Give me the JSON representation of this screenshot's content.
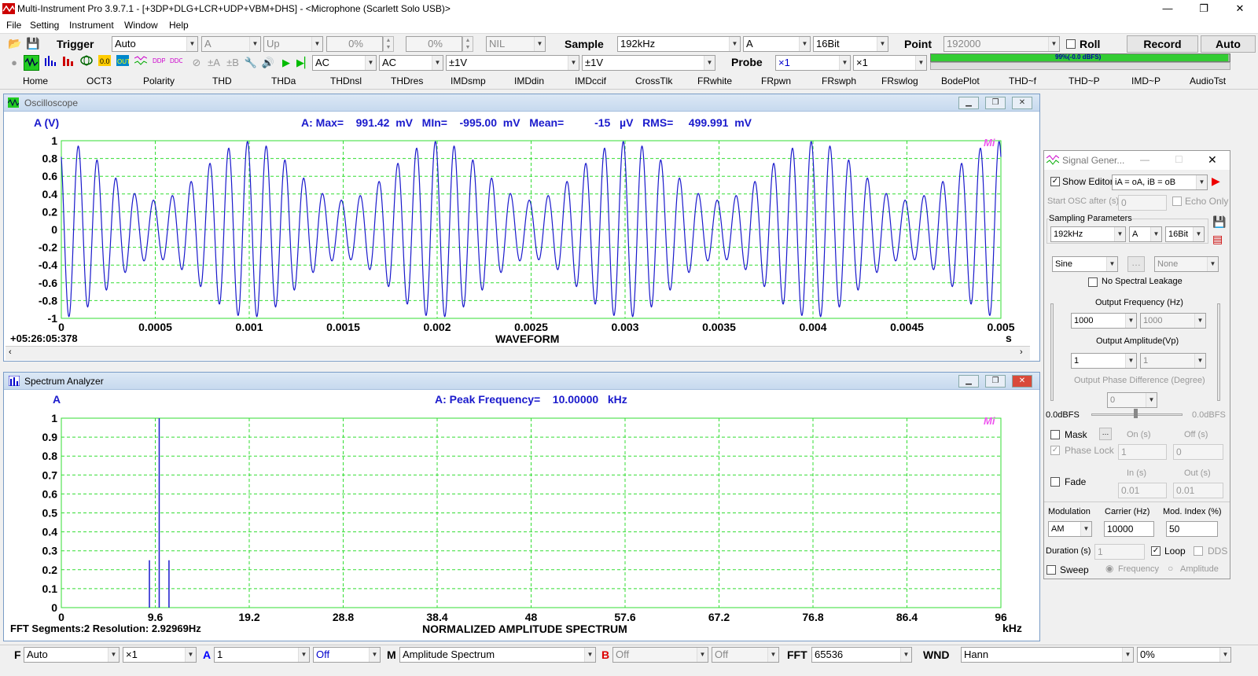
{
  "app": {
    "title": "Multi-Instrument Pro 3.9.7.1  -  [+3DP+DLG+LCR+UDP+VBM+DHS]  -  <Microphone (Scarlett Solo USB)>",
    "win_min": "—",
    "win_max": "❐",
    "win_close": "✕"
  },
  "menu": [
    "File",
    "Setting",
    "Instrument",
    "Window",
    "Help"
  ],
  "toolbar1": {
    "trigger_label": "Trigger",
    "trigger_mode": "Auto",
    "trigger_channel": "A",
    "trigger_edge": "Up",
    "trigger_pct1": "0%",
    "trigger_pct2": "0%",
    "trigger_nil": "NIL",
    "sample_label": "Sample",
    "sample_rate": "192kHz",
    "sample_channel": "A",
    "bit_depth": "16Bit",
    "point_label": "Point",
    "point_value": "192000",
    "roll_label": "Roll",
    "record_label": "Record",
    "auto_label": "Auto"
  },
  "toolbar2": {
    "coupling_a": "AC",
    "coupling_b": "AC",
    "range_a": "±1V",
    "range_b": "±1V",
    "probe_label": "Probe",
    "probe_a": "×1",
    "probe_b": "×1",
    "level_meter": "99%(-0.0 dBFS)",
    "level_fraction": 0.995,
    "icons": [
      "record-dot-icon",
      "oscilloscope-icon",
      "spectrum-icon",
      "bar-meter-icon",
      "phase-icon",
      "generator-icon",
      "multimeter-icon",
      "ddp-icon",
      "ddc-icon",
      "text-a-icon",
      "text-b-icon",
      "probe-icon",
      "speaker-icon",
      "play-icon",
      "play-step-icon"
    ]
  },
  "nav_tabs": [
    "Home",
    "OCT3",
    "Polarity",
    "THD",
    "THDa",
    "THDnsl",
    "THDres",
    "IMDsmp",
    "IMDdin",
    "IMDccif",
    "CrossTlk",
    "FRwhite",
    "FRpwn",
    "FRswph",
    "FRswlog",
    "BodePlot",
    "THD~f",
    "THD~P",
    "IMD~P",
    "AudioTst"
  ],
  "oscilloscope": {
    "window_title": "Oscilloscope",
    "channel_label": "A (V)",
    "stats": "A: Max=    991.42  mV   MIn=    -995.00  mV   Mean=          -15   µV   RMS=     499.991  mV",
    "mi_logo": "Mi",
    "timestamp": "+05:26:05:378",
    "xlabel": "WAVEFORM",
    "xunit": "s",
    "y_ticks": [
      "1",
      "0.8",
      "0.6",
      "0.4",
      "0.2",
      "0",
      "-0.2",
      "-0.4",
      "-0.6",
      "-0.8",
      "-1"
    ],
    "x_ticks": [
      "0",
      "0.0005",
      "0.001",
      "0.0015",
      "0.002",
      "0.0025",
      "0.003",
      "0.0035",
      "0.004",
      "0.0045",
      "0.005"
    ]
  },
  "spectrum": {
    "window_title": "Spectrum Analyzer",
    "channel_label": "A",
    "peak": "A: Peak Frequency=    10.00000   kHz",
    "mi_logo": "Mi",
    "footer_left": "FFT Segments:2   Resolution: 2.92969Hz",
    "xlabel": "NORMALIZED AMPLITUDE SPECTRUM",
    "xunit": "kHz",
    "y_ticks": [
      "1",
      "0.9",
      "0.8",
      "0.7",
      "0.6",
      "0.5",
      "0.4",
      "0.3",
      "0.2",
      "0.1",
      "0"
    ],
    "x_ticks": [
      "0",
      "9.6",
      "19.2",
      "28.8",
      "38.4",
      "48",
      "57.6",
      "67.2",
      "76.8",
      "86.4",
      "96"
    ]
  },
  "chart_data": [
    {
      "type": "line",
      "title": "WAVEFORM",
      "xlabel": "s",
      "ylabel": "A (V)",
      "xlim": [
        0,
        0.005
      ],
      "ylim": [
        -1,
        1
      ],
      "grid": true,
      "signal": "AM sine",
      "carrier_hz": 10000,
      "modulating_hz": 1000,
      "mod_index": 0.5,
      "peak_v": 0.99142,
      "min_v": -0.995,
      "rms_v": 0.499991
    },
    {
      "type": "bar",
      "title": "NORMALIZED AMPLITUDE SPECTRUM",
      "xlabel": "kHz",
      "ylabel": "A",
      "xlim": [
        0,
        96
      ],
      "ylim": [
        0,
        1
      ],
      "grid": true,
      "x": [
        9.0,
        10.0,
        11.0
      ],
      "values": [
        0.25,
        1.0,
        0.25
      ]
    }
  ],
  "siggen": {
    "title": "Signal Gener...",
    "show_editor": "Show Editor",
    "editor_expr": "iA = oA, iB = oB",
    "start_osc": "Start OSC after (s)",
    "start_osc_val": "0",
    "echo_only": "Echo Only",
    "sampling_params": "Sampling Parameters",
    "rate": "192kHz",
    "channel": "A",
    "bits": "16Bit",
    "waveform": "Sine",
    "waveform_b": "None",
    "no_leakage": "No Spectral Leakage",
    "out_freq_label": "Output Frequency (Hz)",
    "freq_a": "1000",
    "freq_b": "1000",
    "out_amp_label": "Output Amplitude(Vp)",
    "amp_a": "1",
    "amp_b": "1",
    "phase_label": "Output Phase Difference (Degree)",
    "phase_val": "0",
    "dbfs_left": "0.0dBFS",
    "dbfs_right": "0.0dBFS",
    "mask": "Mask",
    "on_s": "On (s)",
    "off_s": "Off (s)",
    "phase_lock": "Phase Lock",
    "on_val": "1",
    "off_val": "0",
    "fade": "Fade",
    "in_s": "In (s)",
    "out_s": "Out (s)",
    "in_val": "0.01",
    "out_val": "0.01",
    "modulation": "Modulation",
    "carrier": "Carrier (Hz)",
    "mod_index": "Mod. Index (%)",
    "mod_type": "AM",
    "carrier_val": "10000",
    "mod_index_val": "50",
    "duration": "Duration (s)",
    "duration_val": "1",
    "loop": "Loop",
    "dds": "DDS",
    "sweep": "Sweep",
    "frequency": "Frequency",
    "amplitude": "Amplitude"
  },
  "statusbar": {
    "f_label": "F",
    "f_val": "Auto",
    "f_mult": "×1",
    "a_label": "A",
    "a_val": "1",
    "a_off": "Off",
    "m_label": "M",
    "m_val": "Amplitude Spectrum",
    "b_label": "B",
    "b_val": "Off",
    "b_off": "Off",
    "fft_label": "FFT",
    "fft_val": "65536",
    "wnd_label": "WND",
    "wnd_val": "Hann",
    "pct_val": "0%"
  },
  "colors": {
    "waveform": "#1a1acc",
    "grid": "#33dd33",
    "label_blue": "#1a1acc",
    "mi_logo": "#ee55ee",
    "level_green": "#33cc33",
    "a_red": "#0000ff",
    "b_red": "#dd0000"
  }
}
